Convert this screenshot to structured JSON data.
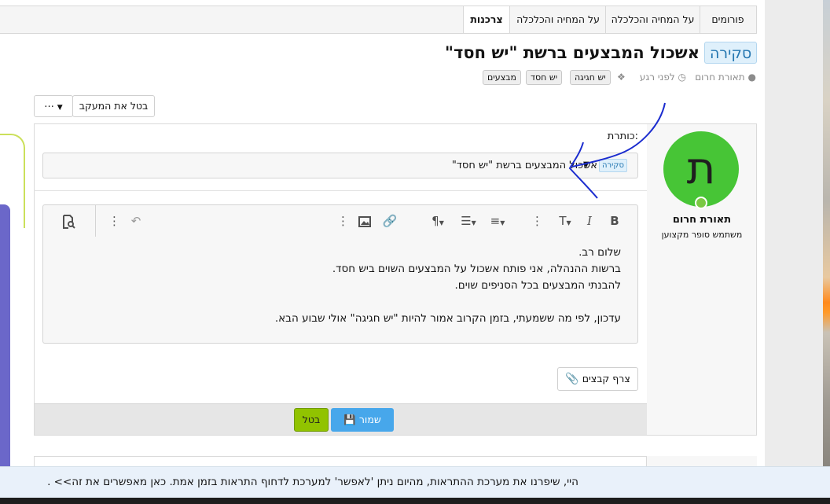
{
  "breadcrumbs": [
    "פורומים",
    "על המחיה והכלכלה",
    "על המחיה והכלכלה",
    "צרכנות"
  ],
  "thread": {
    "prefix": "סקירה",
    "title": "אשכול המבצעים ברשת \"יש חסד\"",
    "author": "תאורת חרום",
    "time": "לפני רגע",
    "tags": [
      "יש חגיגה",
      "יש חסד",
      "מבצעים"
    ]
  },
  "actions": {
    "unwatch_label": "בטל את המעקב",
    "more_label": "⋯"
  },
  "user": {
    "avatar_letter": "ת",
    "name": "תאורת חרום",
    "title": "משתמש סופר מקצוען"
  },
  "editor": {
    "title_field_label": "כותרת:",
    "prefix_chip": "סקירה",
    "title_value": "אשכול המבצעים ברשת \"יש חסד\"",
    "content_lines": [
      "שלום רב.",
      "ברשות ההנהלה, אני פותח אשכול על המבצעים השוים ביש חסד.",
      "להבנתי המבצעים בכל הסניפים שוים.",
      "",
      "עדכון, לפי מה ששמעתי, בזמן הקרוב אמור להיות \"יש חגיגה\" אולי שבוע הבא."
    ],
    "attach_label": "צרף קבצים",
    "save_label": "שמור",
    "cancel_label": "בטל"
  },
  "notice": {
    "text": "היי, שיפרנו את מערכת ההתראות, מהיום ניתן 'לאפשר' למערכת לדחוף התראות בזמן אמת. כאן מאפשרים את זה>> ."
  },
  "colors": {
    "accent_blue": "#47a7eb",
    "cancel_green": "#91c300",
    "avatar_green": "#47c536",
    "prefix_blue": "#2577b1"
  },
  "icons": {
    "bold": "B",
    "italic": "I",
    "text_size": "T",
    "undo": "↶"
  }
}
